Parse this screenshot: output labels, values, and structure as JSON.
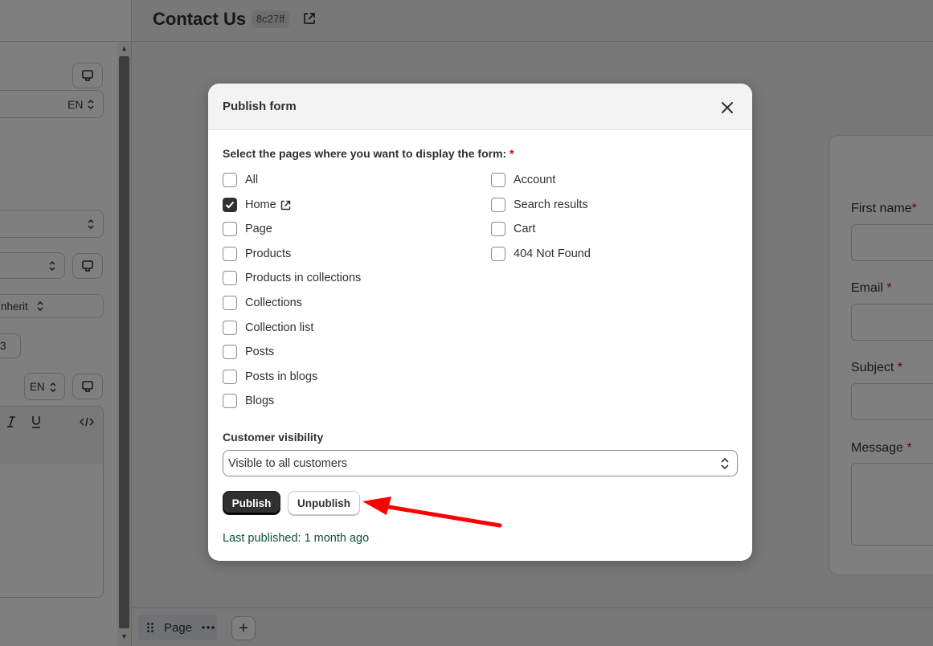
{
  "header": {
    "title": "Contact Us",
    "id_badge": "8c27ff"
  },
  "left_panel": {
    "lang_1": "EN",
    "inherit_text": "nherit",
    "num_partial": "3",
    "lang_2": "EN"
  },
  "form_preview": {
    "fields": [
      {
        "label": "First name",
        "required": "*"
      },
      {
        "label": "Email",
        "required": "*"
      },
      {
        "label": "Subject",
        "required": "*"
      },
      {
        "label": "Message",
        "required": "*"
      }
    ]
  },
  "bottom_bar": {
    "page_chip_label": "Page",
    "add_label": "+"
  },
  "modal": {
    "title": "Publish form",
    "pages_label": "Select the pages where you want to display the form:",
    "required_mark": "*",
    "pages_left": [
      {
        "label": "All",
        "checked": false
      },
      {
        "label": "Home",
        "checked": true
      },
      {
        "label": "Page",
        "checked": false
      },
      {
        "label": "Products",
        "checked": false
      },
      {
        "label": "Products in collections",
        "checked": false
      },
      {
        "label": "Collections",
        "checked": false
      },
      {
        "label": "Collection list",
        "checked": false
      },
      {
        "label": "Posts",
        "checked": false
      },
      {
        "label": "Posts in blogs",
        "checked": false
      },
      {
        "label": "Blogs",
        "checked": false
      }
    ],
    "pages_right": [
      {
        "label": "Account",
        "checked": false
      },
      {
        "label": "Search results",
        "checked": false
      },
      {
        "label": "Cart",
        "checked": false
      },
      {
        "label": "404 Not Found",
        "checked": false
      }
    ],
    "visibility_label": "Customer visibility",
    "visibility_value": "Visible to all customers",
    "publish_label": "Publish",
    "unpublish_label": "Unpublish",
    "last_published": "Last published: 1 month ago"
  },
  "colors": {
    "primary_button": "#303030",
    "annotation_arrow": "#ff0000",
    "success_text": "#0f5132"
  }
}
